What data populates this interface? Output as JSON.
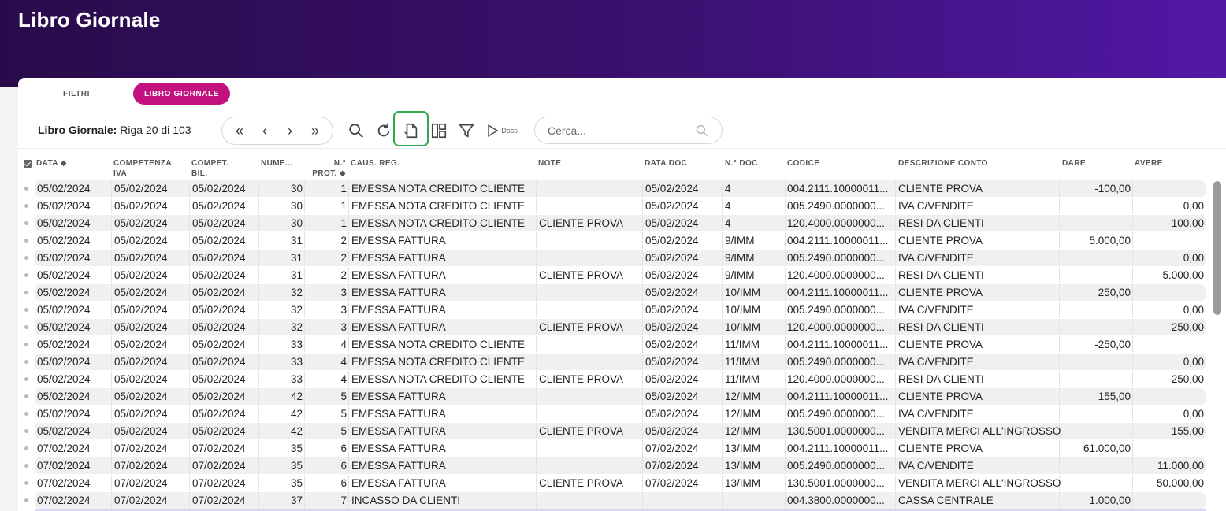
{
  "page": {
    "title": "Libro Giornale"
  },
  "tabs": [
    {
      "label": "FILTRI"
    },
    {
      "label": "LIBRO GIORNALE"
    }
  ],
  "toolbar": {
    "title_bold": "Libro Giornale:",
    "title_rest": " Riga 20 di 103",
    "nav": [
      "first-page",
      "previous",
      "next",
      "last-page"
    ],
    "tools": [
      "search-icon",
      "refresh-icon",
      "export-icon",
      "layout-icon",
      "filter-icon",
      "docs-icon"
    ],
    "docs_label": "Docs",
    "search_placeholder": "Cerca..."
  },
  "columns": {
    "data": "DATA",
    "competenza_iva": [
      "COMPETENZA",
      "IVA"
    ],
    "compet_bil": [
      "COMPET.",
      "BIL."
    ],
    "numero": "NUME...",
    "n_prot": [
      "N.°",
      "PROT."
    ],
    "caus_reg": "CAUS. REG.",
    "note": "NOTE",
    "data_doc": "DATA DOC",
    "n_doc": "N.° DOC",
    "codice": "CODICE",
    "descrizione": "DESCRIZIONE CONTO",
    "dare": "DARE",
    "avere": "AVERE"
  },
  "rows": [
    [
      "05/02/2024",
      "05/02/2024",
      "05/02/2024",
      "30",
      "1",
      "EMESSA NOTA CREDITO CLIENTE",
      "",
      "05/02/2024",
      "4",
      "004.2111.10000011...",
      "CLIENTE PROVA",
      "-100,00",
      ""
    ],
    [
      "05/02/2024",
      "05/02/2024",
      "05/02/2024",
      "30",
      "1",
      "EMESSA NOTA CREDITO CLIENTE",
      "",
      "05/02/2024",
      "4",
      "005.2490.0000000...",
      "IVA C/VENDITE",
      "",
      "0,00"
    ],
    [
      "05/02/2024",
      "05/02/2024",
      "05/02/2024",
      "30",
      "1",
      "EMESSA NOTA CREDITO CLIENTE",
      "CLIENTE PROVA",
      "05/02/2024",
      "4",
      "120.4000.0000000...",
      "RESI DA CLIENTI",
      "",
      "-100,00"
    ],
    [
      "05/02/2024",
      "05/02/2024",
      "05/02/2024",
      "31",
      "2",
      "EMESSA FATTURA",
      "",
      "05/02/2024",
      "9/IMM",
      "004.2111.10000011...",
      "CLIENTE PROVA",
      "5.000,00",
      ""
    ],
    [
      "05/02/2024",
      "05/02/2024",
      "05/02/2024",
      "31",
      "2",
      "EMESSA FATTURA",
      "",
      "05/02/2024",
      "9/IMM",
      "005.2490.0000000...",
      "IVA C/VENDITE",
      "",
      "0,00"
    ],
    [
      "05/02/2024",
      "05/02/2024",
      "05/02/2024",
      "31",
      "2",
      "EMESSA FATTURA",
      "CLIENTE PROVA",
      "05/02/2024",
      "9/IMM",
      "120.4000.0000000...",
      "RESI DA CLIENTI",
      "",
      "5.000,00"
    ],
    [
      "05/02/2024",
      "05/02/2024",
      "05/02/2024",
      "32",
      "3",
      "EMESSA FATTURA",
      "",
      "05/02/2024",
      "10/IMM",
      "004.2111.10000011...",
      "CLIENTE PROVA",
      "250,00",
      ""
    ],
    [
      "05/02/2024",
      "05/02/2024",
      "05/02/2024",
      "32",
      "3",
      "EMESSA FATTURA",
      "",
      "05/02/2024",
      "10/IMM",
      "005.2490.0000000...",
      "IVA C/VENDITE",
      "",
      "0,00"
    ],
    [
      "05/02/2024",
      "05/02/2024",
      "05/02/2024",
      "32",
      "3",
      "EMESSA FATTURA",
      "CLIENTE PROVA",
      "05/02/2024",
      "10/IMM",
      "120.4000.0000000...",
      "RESI DA CLIENTI",
      "",
      "250,00"
    ],
    [
      "05/02/2024",
      "05/02/2024",
      "05/02/2024",
      "33",
      "4",
      "EMESSA NOTA CREDITO CLIENTE",
      "",
      "05/02/2024",
      "11/IMM",
      "004.2111.10000011...",
      "CLIENTE PROVA",
      "-250,00",
      ""
    ],
    [
      "05/02/2024",
      "05/02/2024",
      "05/02/2024",
      "33",
      "4",
      "EMESSA NOTA CREDITO CLIENTE",
      "",
      "05/02/2024",
      "11/IMM",
      "005.2490.0000000...",
      "IVA C/VENDITE",
      "",
      "0,00"
    ],
    [
      "05/02/2024",
      "05/02/2024",
      "05/02/2024",
      "33",
      "4",
      "EMESSA NOTA CREDITO CLIENTE",
      "CLIENTE PROVA",
      "05/02/2024",
      "11/IMM",
      "120.4000.0000000...",
      "RESI DA CLIENTI",
      "",
      "-250,00"
    ],
    [
      "05/02/2024",
      "05/02/2024",
      "05/02/2024",
      "42",
      "5",
      "EMESSA FATTURA",
      "",
      "05/02/2024",
      "12/IMM",
      "004.2111.10000011...",
      "CLIENTE PROVA",
      "155,00",
      ""
    ],
    [
      "05/02/2024",
      "05/02/2024",
      "05/02/2024",
      "42",
      "5",
      "EMESSA FATTURA",
      "",
      "05/02/2024",
      "12/IMM",
      "005.2490.0000000...",
      "IVA C/VENDITE",
      "",
      "0,00"
    ],
    [
      "05/02/2024",
      "05/02/2024",
      "05/02/2024",
      "42",
      "5",
      "EMESSA FATTURA",
      "CLIENTE PROVA",
      "05/02/2024",
      "12/IMM",
      "130.5001.0000000...",
      "VENDITA MERCI ALL'INGROSSO",
      "",
      "155,00"
    ],
    [
      "07/02/2024",
      "07/02/2024",
      "07/02/2024",
      "35",
      "6",
      "EMESSA FATTURA",
      "",
      "07/02/2024",
      "13/IMM",
      "004.2111.10000011...",
      "CLIENTE PROVA",
      "61.000,00",
      ""
    ],
    [
      "07/02/2024",
      "07/02/2024",
      "07/02/2024",
      "35",
      "6",
      "EMESSA FATTURA",
      "",
      "07/02/2024",
      "13/IMM",
      "005.2490.0000000...",
      "IVA C/VENDITE",
      "",
      "11.000,00"
    ],
    [
      "07/02/2024",
      "07/02/2024",
      "07/02/2024",
      "35",
      "6",
      "EMESSA FATTURA",
      "CLIENTE PROVA",
      "07/02/2024",
      "13/IMM",
      "130.5001.0000000...",
      "VENDITA MERCI ALL'INGROSSO",
      "",
      "50.000,00"
    ],
    [
      "07/02/2024",
      "07/02/2024",
      "07/02/2024",
      "37",
      "7",
      "INCASSO DA CLIENTI",
      "",
      "",
      "",
      "004.3800.0000000...",
      "CASSA CENTRALE",
      "1.000,00",
      ""
    ]
  ],
  "colors": {
    "accent": "#c2127f",
    "hero_start": "#2a0b4a",
    "hero_end": "#5218a6",
    "highlight": "#2ea84a"
  }
}
